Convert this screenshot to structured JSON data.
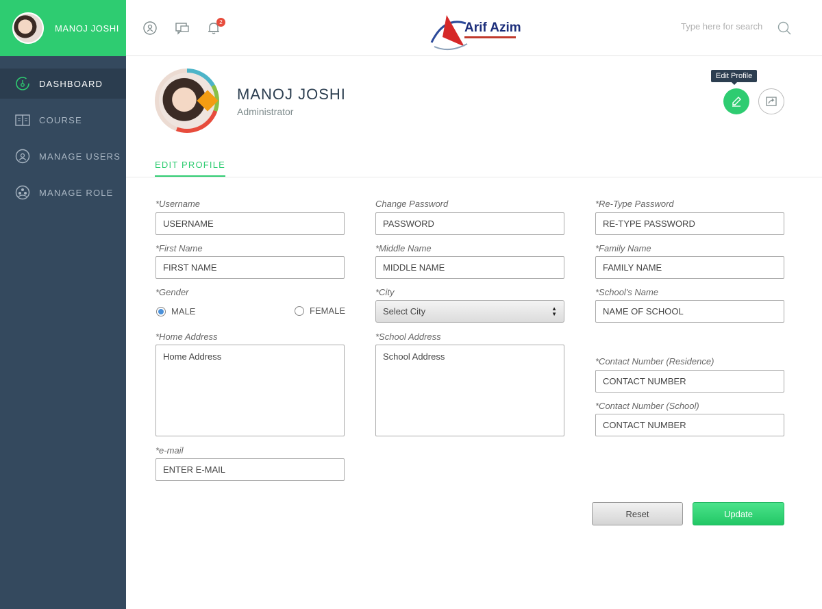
{
  "user": {
    "name": "MANOJ JOSHI",
    "role": "Administrator"
  },
  "sidebar": {
    "items": [
      {
        "label": "DASHBOARD",
        "icon": "dashboard-icon",
        "active": true
      },
      {
        "label": "COURSE",
        "icon": "book-icon",
        "active": false
      },
      {
        "label": "MANAGE USERS",
        "icon": "users-icon",
        "active": false
      },
      {
        "label": "MANAGE ROLE",
        "icon": "role-icon",
        "active": false
      }
    ]
  },
  "topbar": {
    "logo_text": "Arif Azim",
    "notification_count": "2",
    "search_placeholder": "Type here for search"
  },
  "profile": {
    "tooltip": "Edit Profile",
    "tab": "EDIT PROFILE"
  },
  "form": {
    "username": {
      "label": "*Username",
      "placeholder": "USERNAME"
    },
    "change_password": {
      "label": "Change Password",
      "placeholder": "PASSWORD"
    },
    "retype_password": {
      "label": "*Re-Type Password",
      "placeholder": "RE-TYPE PASSWORD"
    },
    "first_name": {
      "label": "*First Name",
      "placeholder": "FIRST NAME"
    },
    "middle_name": {
      "label": "*Middle Name",
      "placeholder": "MIDDLE NAME"
    },
    "family_name": {
      "label": "*Family Name",
      "placeholder": "FAMILY NAME"
    },
    "gender": {
      "label": "*Gender",
      "male": "MALE",
      "female": "FEMALE",
      "selected": "MALE"
    },
    "city": {
      "label": "*City",
      "value": "Select City"
    },
    "school_name": {
      "label": "*School's Name",
      "placeholder": "NAME OF SCHOOL"
    },
    "home_address": {
      "label": "*Home Address",
      "placeholder": "Home Address"
    },
    "school_address": {
      "label": "*School Address",
      "placeholder": "School Address"
    },
    "contact_residence": {
      "label": "*Contact Number (Residence)",
      "placeholder": "CONTACT NUMBER"
    },
    "contact_school": {
      "label": "*Contact Number (School)",
      "placeholder": "CONTACT NUMBER"
    },
    "email": {
      "label": "*e-mail",
      "placeholder": "ENTER E-MAIL"
    }
  },
  "buttons": {
    "reset": "Reset",
    "update": "Update"
  },
  "colors": {
    "accent": "#2ecc71",
    "sidebar": "#34495e",
    "sidebar_active": "#2b3d4f",
    "badge": "#e74c3c"
  }
}
